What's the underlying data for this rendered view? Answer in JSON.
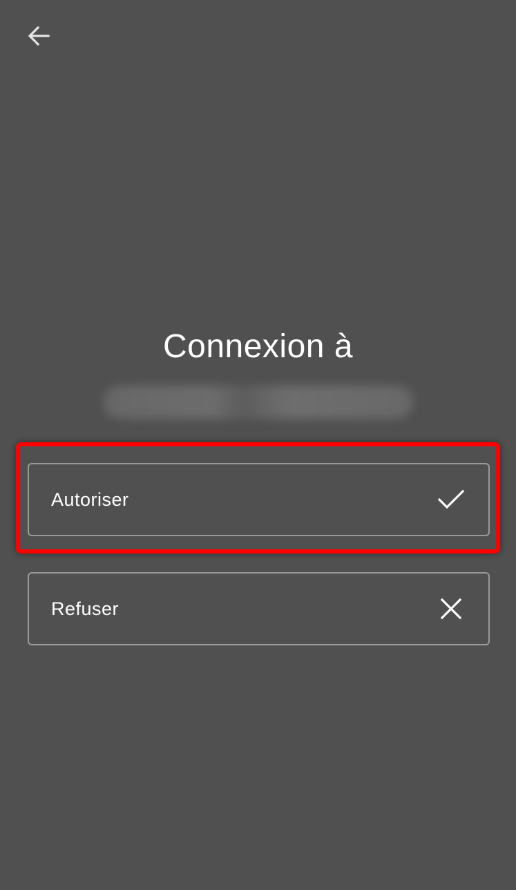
{
  "header": {
    "back_icon": "arrow-left-icon"
  },
  "main": {
    "title": "Connexion à",
    "host_redacted": true
  },
  "options": {
    "allow": {
      "label": "Autoriser",
      "icon": "checkmark-icon"
    },
    "deny": {
      "label": "Refuser",
      "icon": "close-icon"
    }
  },
  "colors": {
    "background": "#505050",
    "text": "#ffffff",
    "border": "#9a9a9a",
    "highlight": "#ff0000"
  }
}
